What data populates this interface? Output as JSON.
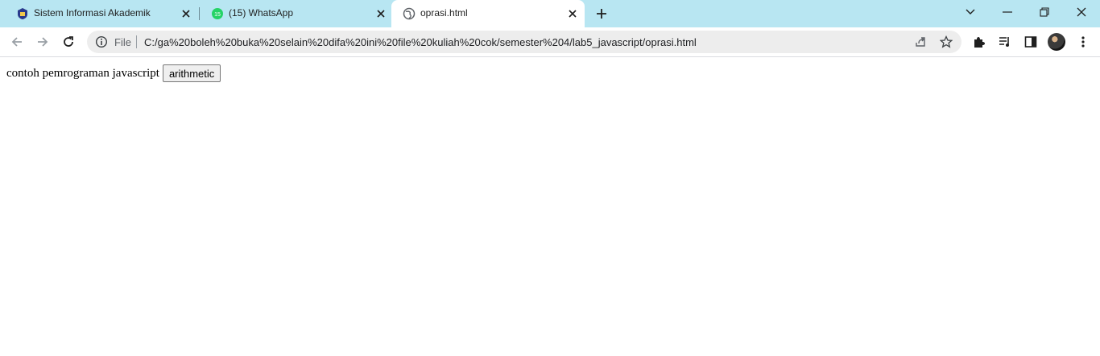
{
  "tabs": [
    {
      "title": "Sistem Informasi Akademik",
      "favicon": "university-logo-icon",
      "active": false
    },
    {
      "title": "(15) WhatsApp",
      "favicon": "whatsapp-icon",
      "badge": "15",
      "active": false
    },
    {
      "title": "oprasi.html",
      "favicon": "globe-icon",
      "active": true
    }
  ],
  "omnibox": {
    "scheme_label": "File",
    "url": "C:/ga%20boleh%20buka%20selain%20difa%20ini%20file%20kuliah%20cok/semester%204/lab5_javascript/oprasi.html"
  },
  "page": {
    "text": "contoh pemrograman javascript",
    "button_label": "arithmetic"
  },
  "colors": {
    "tabstrip": "#b8e6f2",
    "omnibox": "#ededed",
    "whatsapp_green": "#25d366"
  }
}
